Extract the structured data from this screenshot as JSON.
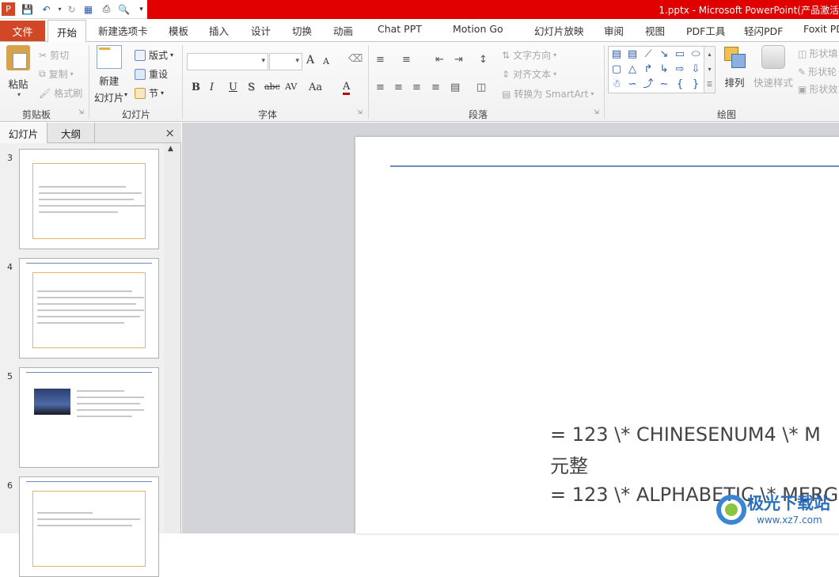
{
  "window": {
    "title": "1.pptx - Microsoft PowerPoint(产品激活"
  },
  "tabs": {
    "file": "文件",
    "home": "开始",
    "items": [
      "新建选项卡",
      "模板",
      "插入",
      "设计",
      "切换",
      "动画",
      "Chat PPT",
      "Motion Go",
      "幻灯片放映",
      "审阅",
      "视图",
      "PDF工具",
      "轻闪PDF",
      "Foxit PD"
    ]
  },
  "ribbon": {
    "clipboard": {
      "paste": "粘贴",
      "cut": "剪切",
      "copy": "复制",
      "format_painter": "格式刷",
      "label": "剪贴板"
    },
    "slides": {
      "new_slide_line1": "新建",
      "new_slide_line2": "幻灯片",
      "layout": "版式",
      "reset": "重设",
      "section": "节",
      "label": "幻灯片"
    },
    "font": {
      "label": "字体",
      "bold": "B",
      "italic": "I",
      "underline": "U",
      "shadow": "S",
      "strike": "abc",
      "spacing": "AV",
      "case": "Aa",
      "color": "A",
      "grow": "A",
      "shrink": "A"
    },
    "paragraph": {
      "text_direction": "文字方向",
      "align_text": "对齐文本",
      "convert_smartart": "转换为 SmartArt",
      "label": "段落"
    },
    "drawing": {
      "arrange": "排列",
      "quick_styles": "快速样式",
      "shape_fill": "形状填",
      "shape_outline": "形状轮",
      "shape_effects": "形状效",
      "label": "绘图"
    }
  },
  "panel": {
    "tab_slides": "幻灯片",
    "tab_outline": "大纲",
    "close": "×",
    "thumbs": [
      {
        "num": "3"
      },
      {
        "num": "4"
      },
      {
        "num": "5"
      },
      {
        "num": "6"
      }
    ]
  },
  "slide": {
    "line1": "= 123 \\* CHINESENUM4 \\* M",
    "line2": "元整",
    "line3": "= 123 \\* ALPHABETIC \\* MERG"
  },
  "watermark": {
    "text": "极光下载站",
    "url": "www.xz7.com"
  }
}
